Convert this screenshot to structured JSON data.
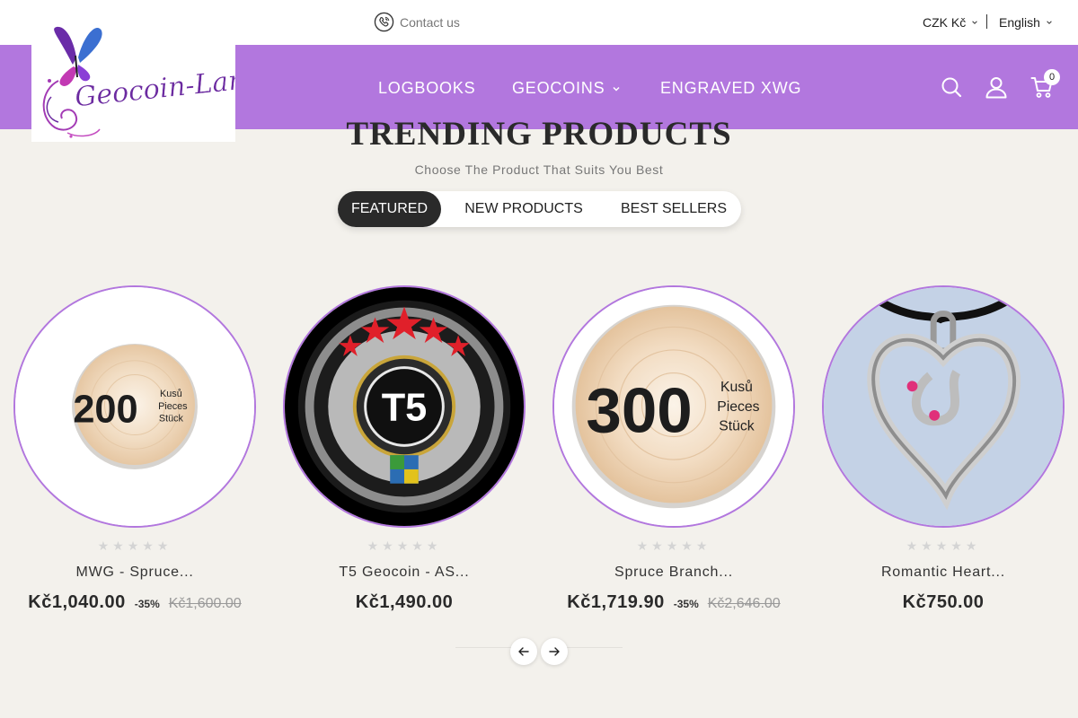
{
  "header": {
    "contact_label": "Contact us",
    "currency_label": "CZK Kč",
    "language_label": "English",
    "logo_text": "Geocoin-Land"
  },
  "nav": {
    "items": [
      "LOGBOOKS",
      "GEOCOINS",
      "ENGRAVED XWG"
    ],
    "cart_count": "0"
  },
  "section": {
    "title": "TRENDING PRODUCTS",
    "subtitle": "Choose The Product That Suits You Best",
    "tabs": [
      "FEATURED",
      "NEW PRODUCTS",
      "BEST SELLERS"
    ],
    "active_tab": "FEATURED"
  },
  "products": [
    {
      "name": "MWG - Spruce...",
      "price": "Kč1,040.00",
      "discount": "-35%",
      "old_price": "Kč1,600.00",
      "image_text": [
        "200",
        "Kusů",
        "Pieces",
        "Stück"
      ],
      "rating": 0
    },
    {
      "name": "T5 Geocoin - AS...",
      "price": "Kč1,490.00",
      "discount": "",
      "old_price": "",
      "image_text": [
        "T5"
      ],
      "rating": 0
    },
    {
      "name": "Spruce Branch...",
      "price": "Kč1,719.90",
      "discount": "-35%",
      "old_price": "Kč2,646.00",
      "image_text": [
        "300",
        "Kusů",
        "Pieces",
        "Stück"
      ],
      "rating": 0
    },
    {
      "name": "Romantic Heart...",
      "price": "Kč750.00",
      "discount": "",
      "old_price": "",
      "image_text": [],
      "rating": 0
    }
  ],
  "colors": {
    "brand_purple": "#b277de",
    "background": "#f3f1ec",
    "dark": "#2a2a2a"
  },
  "icons": {
    "contact": "phone-icon",
    "search": "search-icon",
    "account": "user-icon",
    "cart": "cart-icon",
    "prev": "arrow-left-icon",
    "next": "arrow-right-icon"
  }
}
